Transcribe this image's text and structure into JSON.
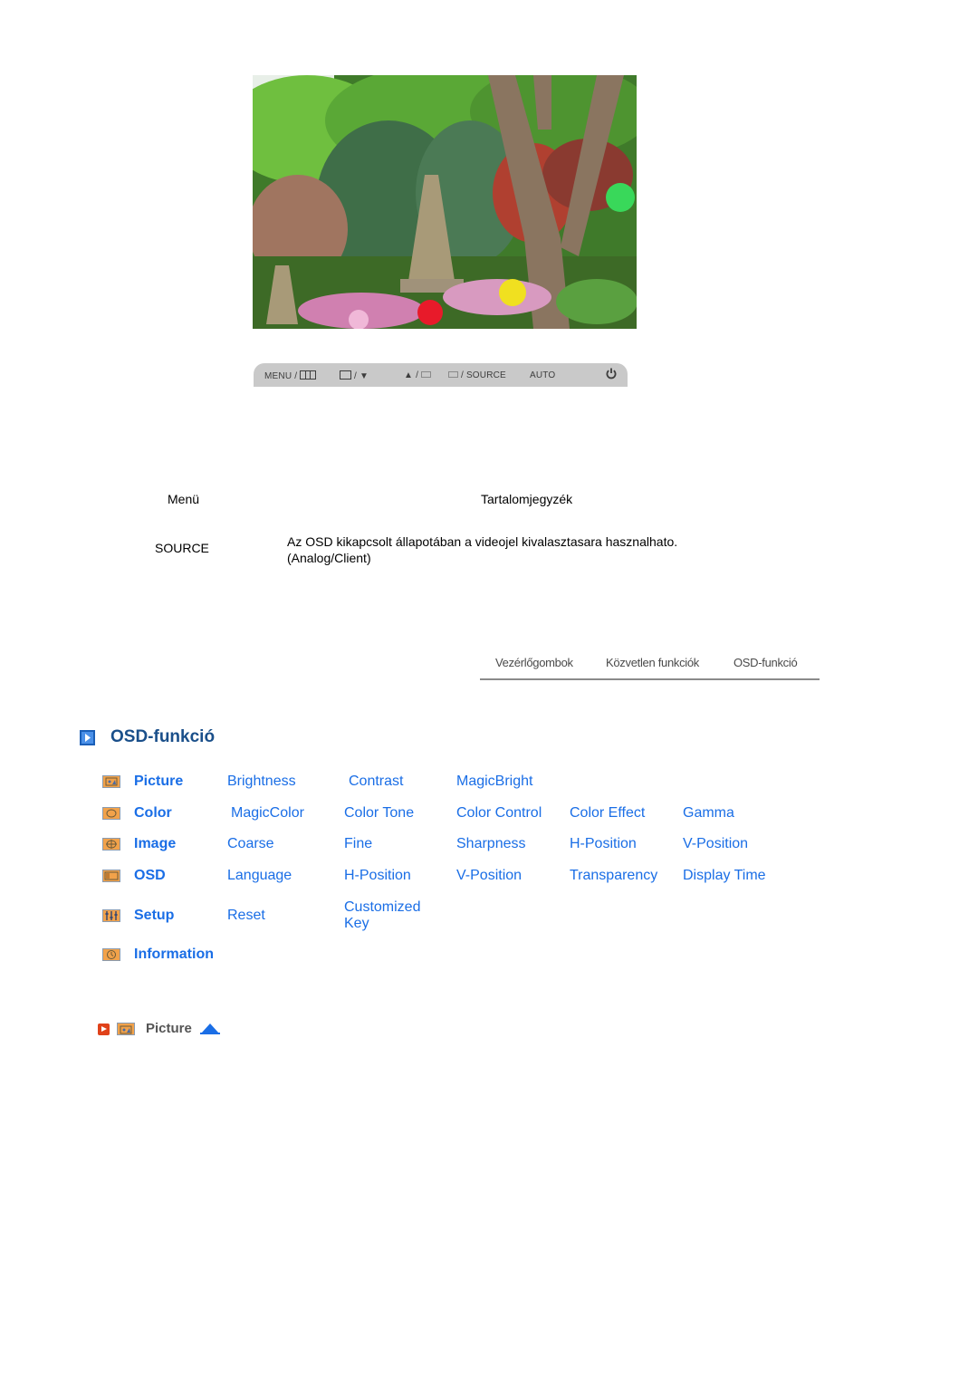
{
  "photo": {
    "alt": "garden-with-pagodas-and-lanterns"
  },
  "control_strip": {
    "menu_label": "MENU /",
    "down_label": "/ ▼",
    "up_label": "▲ /",
    "source_label": "/ SOURCE",
    "auto_label": "AUTO",
    "power_glyph": "⏻"
  },
  "menu_table": {
    "header_menu": "Menü",
    "header_content": "Tartalomjegyzék",
    "rows": [
      {
        "menu": "SOURCE",
        "description": "Az OSD kikapcsolt állapotában a videojel kivalasztasara hasznalhato. (Analog/Client)"
      }
    ]
  },
  "nav_tabs": [
    {
      "label": "Vezérlőgombok"
    },
    {
      "label": "Közvetlen funkciók"
    },
    {
      "label": "OSD-funkció"
    }
  ],
  "section": {
    "title": "OSD-funkció"
  },
  "osd_menu": [
    {
      "category": "Picture",
      "icon": "picture-icon",
      "items": [
        "Brightness",
        "Contrast",
        "MagicBright"
      ]
    },
    {
      "category": "Color",
      "icon": "color-icon",
      "items": [
        "MagicColor",
        "Color Tone",
        "Color Control",
        "Color Effect",
        "Gamma"
      ]
    },
    {
      "category": "Image",
      "icon": "image-icon",
      "items": [
        "Coarse",
        "Fine",
        "Sharpness",
        "H-Position",
        "V-Position"
      ]
    },
    {
      "category": "OSD",
      "icon": "osd-icon",
      "items": [
        "Language",
        "H-Position",
        "V-Position",
        "Transparency",
        "Display Time"
      ]
    },
    {
      "category": "Setup",
      "icon": "setup-icon",
      "items": [
        "Reset",
        "Customized Key"
      ]
    },
    {
      "category": "Information",
      "icon": "information-icon",
      "items": []
    }
  ],
  "subsection": {
    "title": "Picture"
  },
  "colors": {
    "link": "#1a6ee6",
    "title": "#1a4f8a",
    "accent_red": "#e0421a",
    "icon_orange": "#f2a24a"
  }
}
